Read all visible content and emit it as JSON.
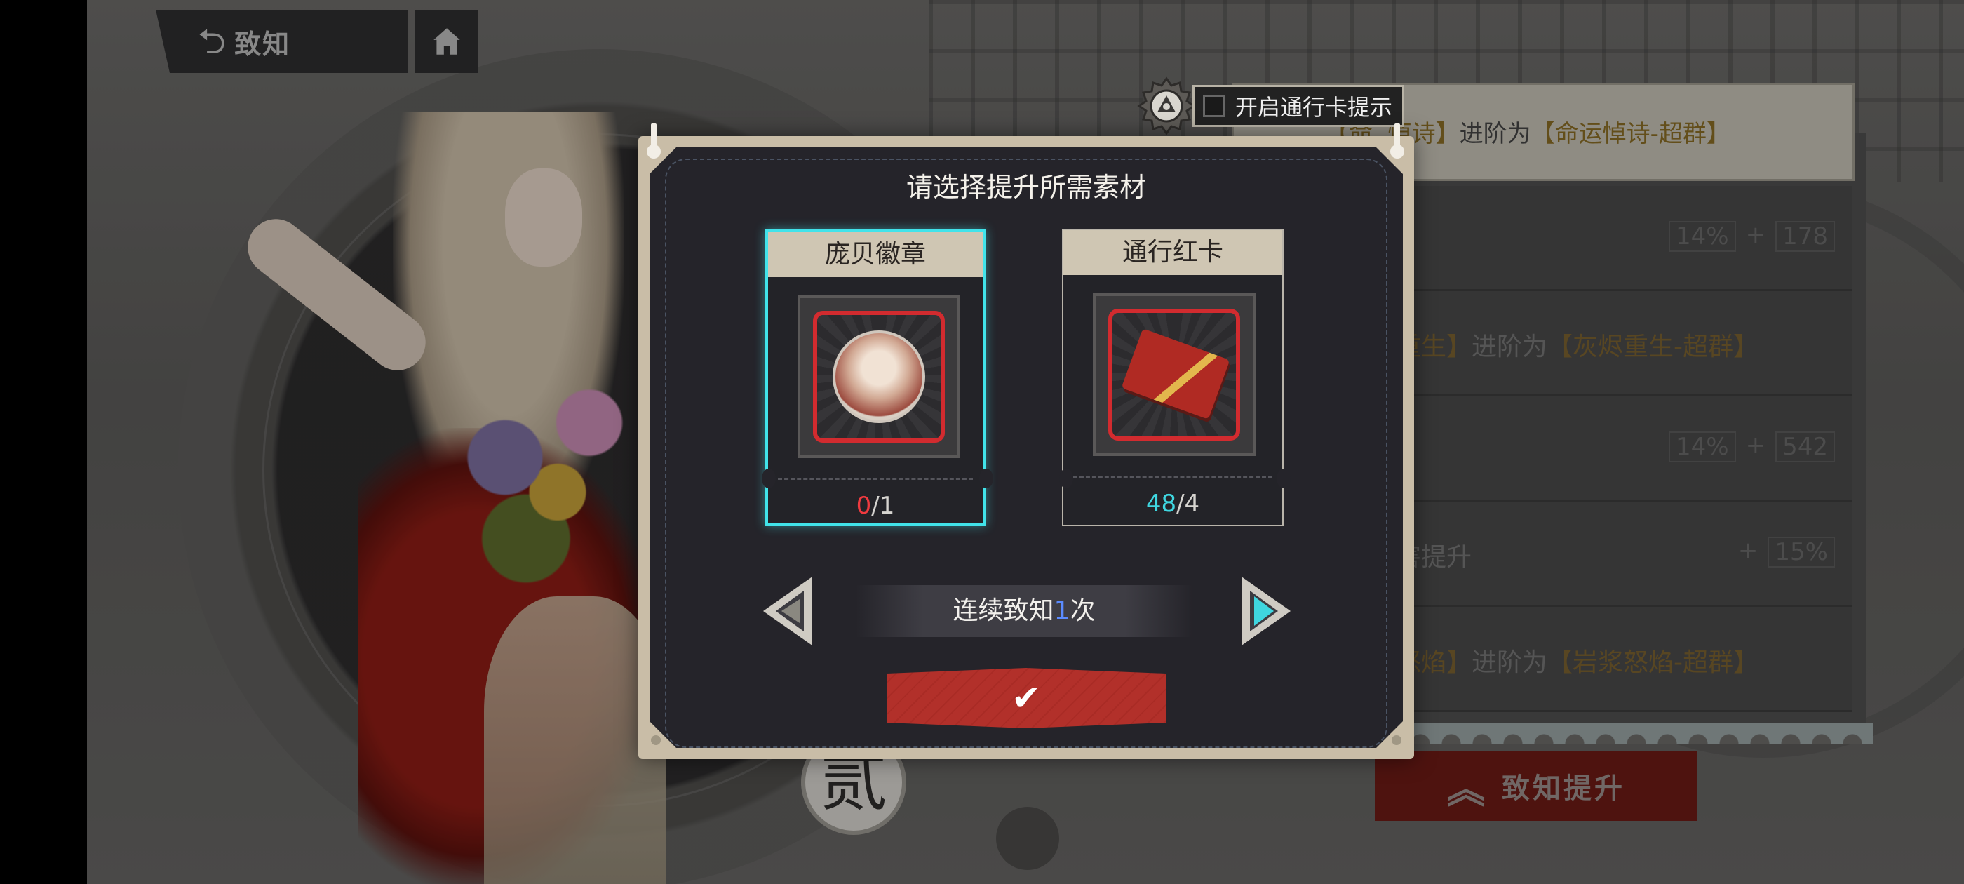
{
  "nav": {
    "back_label": "致知",
    "back_icon": "return-arrow-icon",
    "home_icon": "home-icon"
  },
  "background": {
    "emblem_text": "贰",
    "header_line": {
      "prefix": "【命运悼诗】",
      "mid": "进阶为",
      "target": "【命运悼诗-超群】",
      "visible_prefix": "【命  悼诗】"
    },
    "rows": [
      {
        "type": "stat",
        "pct": "14%",
        "plus": "+",
        "value": "178"
      },
      {
        "type": "text",
        "prefix": "重生】",
        "mid": "进阶为",
        "target": "【灰烬重生-超群】"
      },
      {
        "type": "stat",
        "pct": "14%",
        "plus": "+",
        "value": "542"
      },
      {
        "type": "text2",
        "prefix": "害提升",
        "plus": "+",
        "value": "15%"
      },
      {
        "type": "text",
        "prefix": "怒焰】",
        "mid": "进阶为",
        "target": "【岩浆怒焰-超群】"
      }
    ],
    "upgrade_button": "致知提升"
  },
  "pass_hint": {
    "label": "开启通行卡提示",
    "checked": false
  },
  "modal": {
    "title": "请选择提升所需素材",
    "materials": [
      {
        "name": "庞贝徽章",
        "have": "0",
        "need": "1",
        "selected": true,
        "icon": "pompeii-badge-icon",
        "have_color": "#ef3a3f"
      },
      {
        "name": "通行红卡",
        "have": "48",
        "need": "4",
        "selected": false,
        "icon": "red-pass-card-icon",
        "have_color": "#3fd6e0"
      }
    ],
    "count_prefix": "连续致知",
    "count_value": "1",
    "count_suffix": "次",
    "confirm_icon": "checkmark-icon"
  },
  "colors": {
    "accent_cyan": "#41e3ea",
    "confirm_red": "#b2302a",
    "count_blue": "#5b8bff"
  }
}
